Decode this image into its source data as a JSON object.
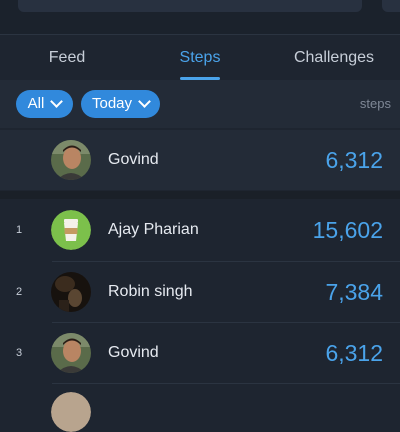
{
  "tabs": [
    {
      "label": "Feed"
    },
    {
      "label": "Steps"
    },
    {
      "label": "Challenges"
    }
  ],
  "filters": {
    "scope": "All",
    "period": "Today",
    "unit": "steps"
  },
  "colors": {
    "accent": "#4aa3ea",
    "pill": "#3189dc",
    "background": "#1e2530"
  },
  "current_user": {
    "name": "Govind",
    "steps": "6,312"
  },
  "leaderboard": [
    {
      "rank": "1",
      "name": "Ajay Pharian",
      "steps": "15,602",
      "avatar": "coffee-cup-avatar"
    },
    {
      "rank": "2",
      "name": "Robin singh",
      "steps": "7,384",
      "avatar": "photo-avatar"
    },
    {
      "rank": "3",
      "name": "Govind",
      "steps": "6,312",
      "avatar": "photo-avatar"
    }
  ]
}
